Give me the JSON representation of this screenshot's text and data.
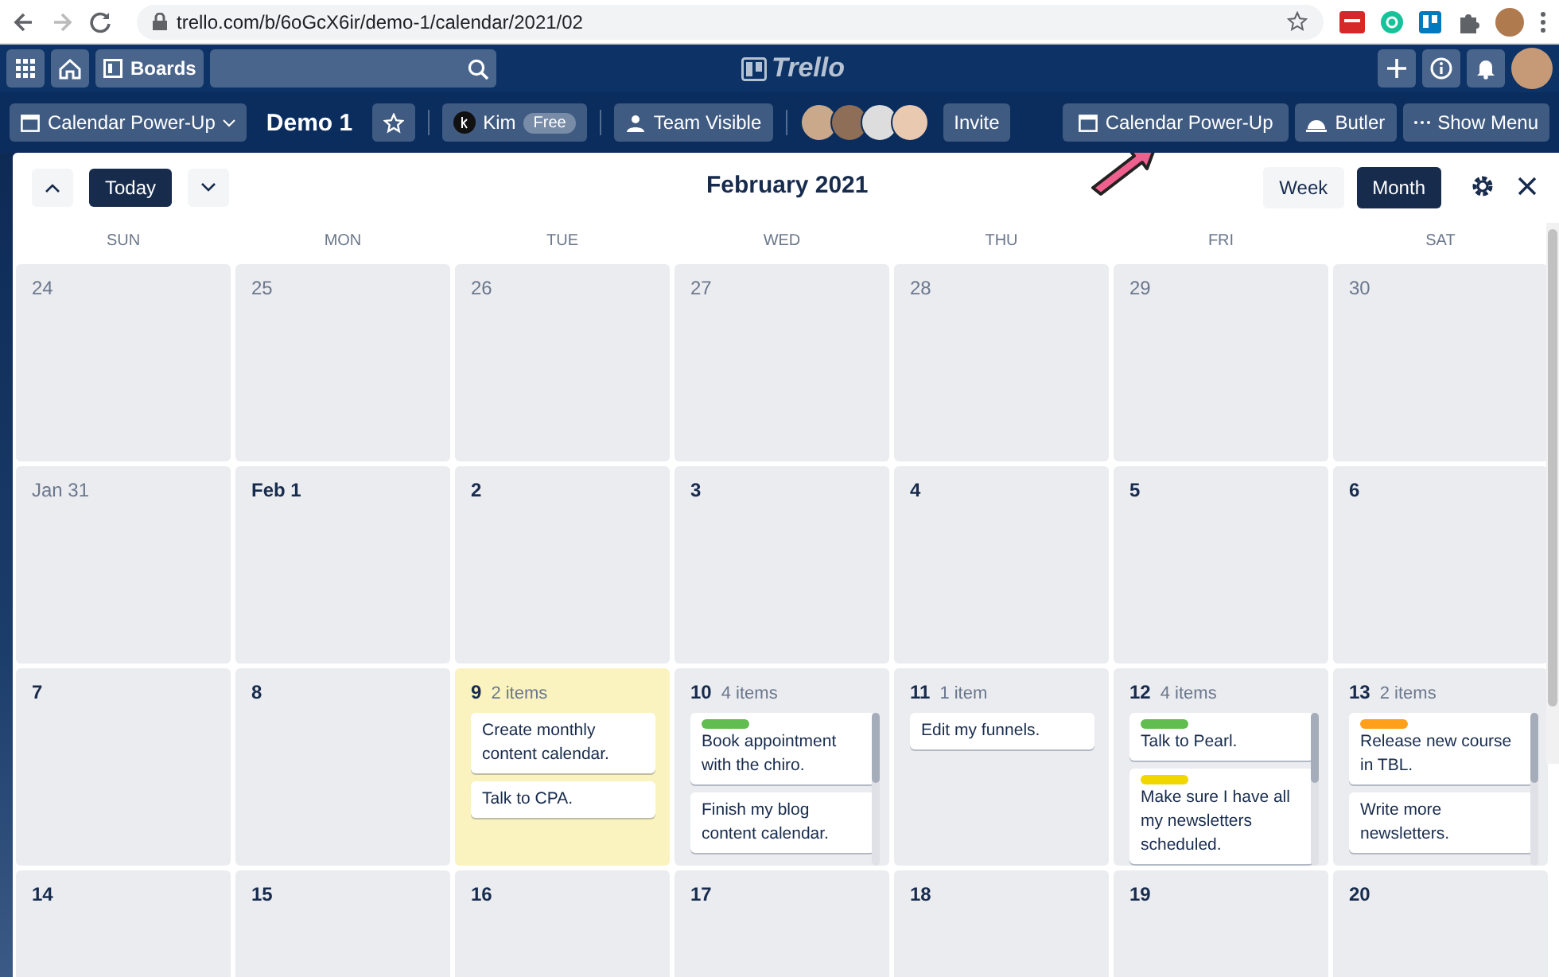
{
  "browser": {
    "url": "trello.com/b/6oGcX6ir/demo-1/calendar/2021/02"
  },
  "header": {
    "boards": "Boards",
    "logo": "Trello"
  },
  "board_bar": {
    "power_up_menu": "Calendar Power-Up",
    "board_name": "Demo 1",
    "workspace": "Kim",
    "workspace_badge": "Free",
    "visibility": "Team Visible",
    "invite": "Invite",
    "calendar_button": "Calendar Power-Up",
    "butler": "Butler",
    "show_menu": "Show Menu"
  },
  "calendar": {
    "today_button": "Today",
    "title": "February 2021",
    "views": [
      {
        "label": "Week",
        "selected": false
      },
      {
        "label": "Month",
        "selected": true
      }
    ],
    "weekdays": [
      "SUN",
      "MON",
      "TUE",
      "WED",
      "THU",
      "FRI",
      "SAT"
    ],
    "weeks": [
      [
        {
          "day": "24",
          "in_month": false,
          "today": false
        },
        {
          "day": "25",
          "in_month": false,
          "today": false
        },
        {
          "day": "26",
          "in_month": false,
          "today": false
        },
        {
          "day": "27",
          "in_month": false,
          "today": false
        },
        {
          "day": "28",
          "in_month": false,
          "today": false
        },
        {
          "day": "29",
          "in_month": false,
          "today": false
        },
        {
          "day": "30",
          "in_month": false,
          "today": false
        }
      ],
      [
        {
          "day": "Jan 31",
          "in_month": false,
          "today": false
        },
        {
          "day": "Feb 1",
          "in_month": true,
          "today": false
        },
        {
          "day": "2",
          "in_month": true,
          "today": false
        },
        {
          "day": "3",
          "in_month": true,
          "today": false
        },
        {
          "day": "4",
          "in_month": true,
          "today": false
        },
        {
          "day": "5",
          "in_month": true,
          "today": false
        },
        {
          "day": "6",
          "in_month": true,
          "today": false
        }
      ],
      [
        {
          "day": "7",
          "in_month": true,
          "today": false
        },
        {
          "day": "8",
          "in_month": true,
          "today": false
        },
        {
          "day": "9",
          "in_month": true,
          "today": true,
          "count": "2 items",
          "scrollable": false,
          "cards": [
            {
              "text": "Create monthly content calendar."
            },
            {
              "text": "Talk to CPA."
            }
          ]
        },
        {
          "day": "10",
          "in_month": true,
          "today": false,
          "count": "4 items",
          "scrollable": true,
          "cards": [
            {
              "text": "Book appointment with the chiro.",
              "color": "#61bd4f"
            },
            {
              "text": "Finish my blog content calendar."
            }
          ]
        },
        {
          "day": "11",
          "in_month": true,
          "today": false,
          "count": "1 item",
          "scrollable": false,
          "cards": [
            {
              "text": "Edit my funnels."
            }
          ]
        },
        {
          "day": "12",
          "in_month": true,
          "today": false,
          "count": "4 items",
          "scrollable": true,
          "cards": [
            {
              "text": "Talk to Pearl.",
              "color": "#61bd4f"
            },
            {
              "text": "Make sure I have all my newsletters scheduled.",
              "color": "#f2d600"
            }
          ]
        },
        {
          "day": "13",
          "in_month": true,
          "today": false,
          "count": "2 items",
          "scrollable": true,
          "cards": [
            {
              "text": "Release new course in TBL.",
              "color": "#ff9f1a"
            },
            {
              "text": "Write more newsletters."
            }
          ]
        }
      ],
      [
        {
          "day": "14",
          "in_month": true,
          "today": false
        },
        {
          "day": "15",
          "in_month": true,
          "today": false
        },
        {
          "day": "16",
          "in_month": true,
          "today": false
        },
        {
          "day": "17",
          "in_month": true,
          "today": false
        },
        {
          "day": "18",
          "in_month": true,
          "today": false
        },
        {
          "day": "19",
          "in_month": true,
          "today": false
        },
        {
          "day": "20",
          "in_month": true,
          "today": false
        }
      ]
    ]
  }
}
